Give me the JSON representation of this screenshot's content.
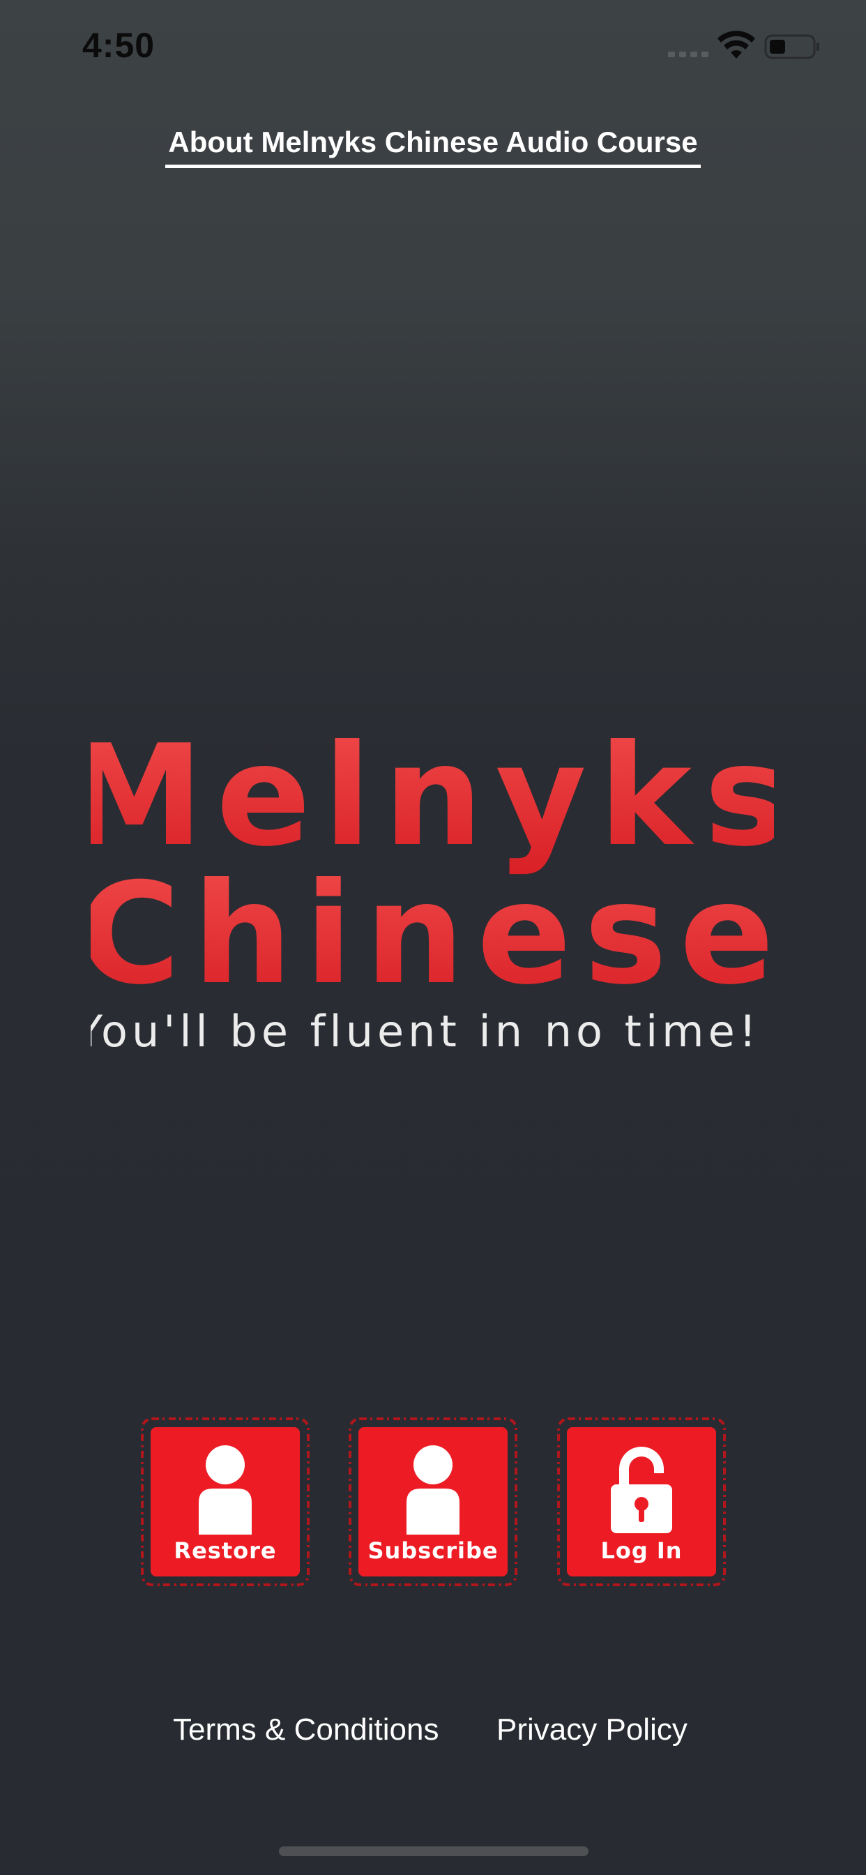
{
  "status_bar": {
    "time": "4:50",
    "icons": [
      "cellular-signal-icon",
      "wifi-icon",
      "battery-icon"
    ]
  },
  "header": {
    "about_link": "About Melnyks Chinese Audio Course"
  },
  "logo": {
    "line1": "Melnyks",
    "line2": "Chinese",
    "tagline": "You'll be fluent in no time!",
    "brand_color": "#e8282b"
  },
  "actions": {
    "restore": {
      "label": "Restore",
      "icon": "person-icon"
    },
    "subscribe": {
      "label": "Subscribe",
      "icon": "person-icon"
    },
    "login": {
      "label": "Log In",
      "icon": "unlocked-padlock-icon"
    }
  },
  "footer": {
    "terms": "Terms & Conditions",
    "privacy": "Privacy Policy"
  },
  "colors": {
    "button_red": "#ed1c24",
    "background_top": "#3d4245",
    "background_bottom": "#282b31"
  }
}
